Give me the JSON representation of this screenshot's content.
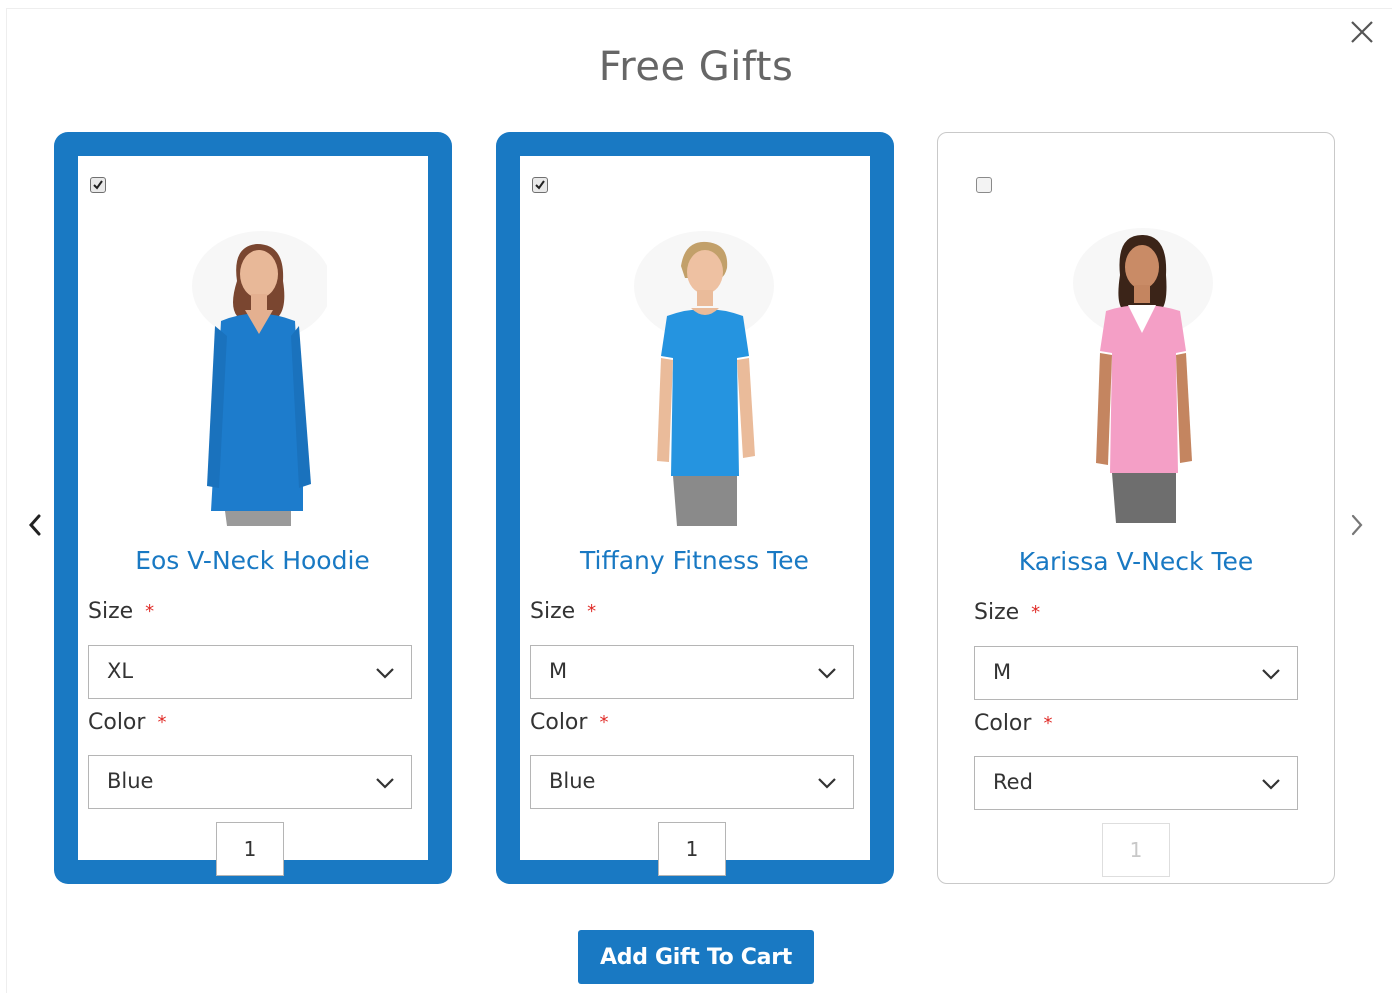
{
  "modal": {
    "title": "Free Gifts",
    "add_button_label": "Add Gift To Cart"
  },
  "icons": {
    "close": "close-icon",
    "prev": "chevron-left-icon",
    "next": "chevron-right-icon",
    "dropdown": "chevron-down-icon"
  },
  "colors": {
    "accent": "#1979c3",
    "required": "#e02b27"
  },
  "products": [
    {
      "name": "Eos V-Neck Hoodie",
      "selected": true,
      "size_label": "Size",
      "size_value": "XL",
      "color_label": "Color",
      "color_value": "Blue",
      "qty": "1",
      "required_mark": "*",
      "garment_color": "#1d7ccc"
    },
    {
      "name": "Tiffany Fitness Tee",
      "selected": true,
      "size_label": "Size",
      "size_value": "M",
      "color_label": "Color",
      "color_value": "Blue",
      "qty": "1",
      "required_mark": "*",
      "garment_color": "#2594e0"
    },
    {
      "name": "Karissa V-Neck Tee",
      "selected": false,
      "size_label": "Size",
      "size_value": "M",
      "color_label": "Color",
      "color_value": "Red",
      "qty": "1",
      "required_mark": "*",
      "garment_color": "#f49fc6"
    }
  ]
}
